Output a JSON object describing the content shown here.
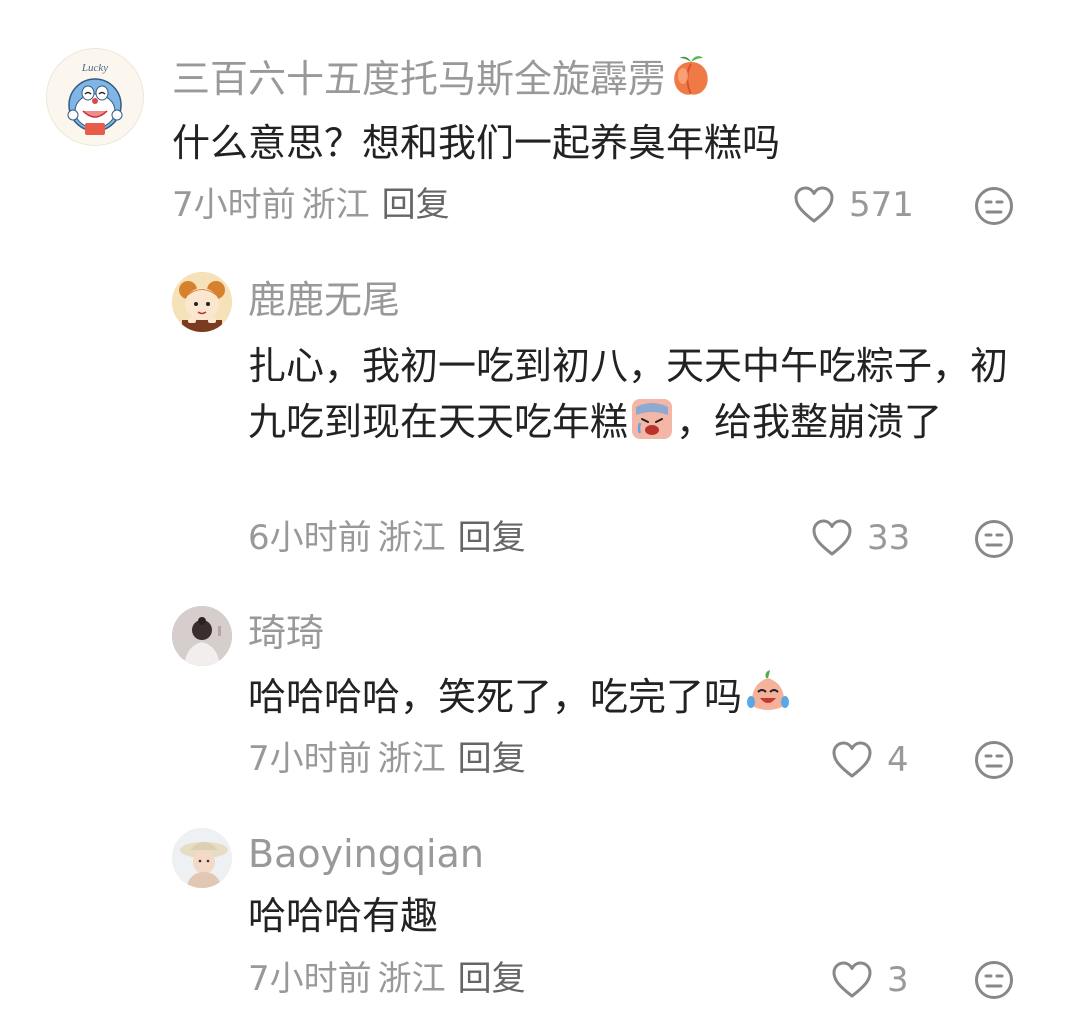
{
  "comments": [
    {
      "username": "三百六十五度托马斯全旋霹雳",
      "username_emoji": "peach-emoji",
      "text": "什么意思？想和我们一起养臭年糕吗",
      "time": "7小时前",
      "location": "浙江",
      "reply_label": "回复",
      "likes": "571",
      "avatar": "doraemon-lucky-avatar",
      "avatar_label": "Lucky"
    },
    {
      "username": "鹿鹿无尾",
      "text_part1": "扎心，我初一吃到初八，天天中午吃粽子，初九吃到现在天天吃年糕",
      "text_emoji": "crying-emoji",
      "text_part2": "，给我整崩溃了",
      "time": "6小时前",
      "location": "浙江",
      "reply_label": "回复",
      "likes": "33",
      "avatar": "cartoon-girl-avatar"
    },
    {
      "username": "琦琦",
      "text": "哈哈哈哈，笑死了，吃完了吗",
      "text_emoji": "laughing-tears-emoji",
      "time": "7小时前",
      "location": "浙江",
      "reply_label": "回复",
      "likes": "4",
      "avatar": "woman-back-avatar"
    },
    {
      "username": "Baoyingqian",
      "text": "哈哈哈有趣",
      "time": "7小时前",
      "location": "浙江",
      "reply_label": "回复",
      "likes": "3",
      "avatar": "girl-hat-avatar"
    }
  ],
  "icons": {
    "like": "heart-outline-icon",
    "dislike": "neutral-face-icon"
  },
  "colors": {
    "username": "#999999",
    "text": "#222222",
    "meta": "#999999",
    "icon": "#888888"
  }
}
